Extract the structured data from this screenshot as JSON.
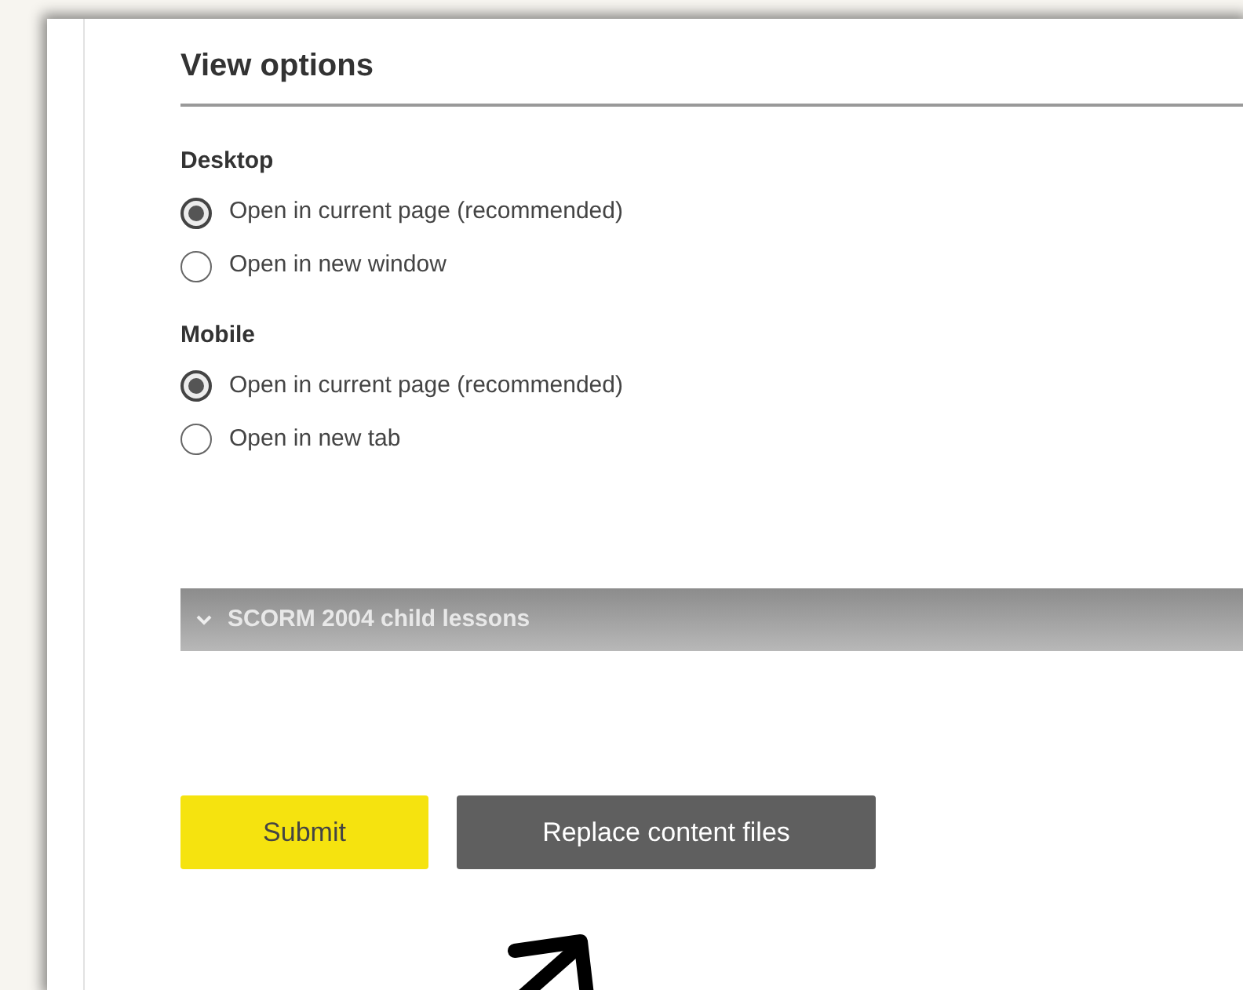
{
  "section": {
    "title": "View options"
  },
  "groups": [
    {
      "label": "Desktop",
      "options": [
        {
          "label": "Open in current page (recommended)",
          "selected": true
        },
        {
          "label": "Open in new window",
          "selected": false
        }
      ]
    },
    {
      "label": "Mobile",
      "options": [
        {
          "label": "Open in current page (recommended)",
          "selected": true
        },
        {
          "label": "Open in new tab",
          "selected": false
        }
      ]
    }
  ],
  "collapsible": {
    "label": "SCORM 2004 child lessons",
    "expanded": false
  },
  "buttons": [
    {
      "label": "Submit",
      "kind": "primary"
    },
    {
      "label": "Replace content files",
      "kind": "secondary"
    }
  ]
}
